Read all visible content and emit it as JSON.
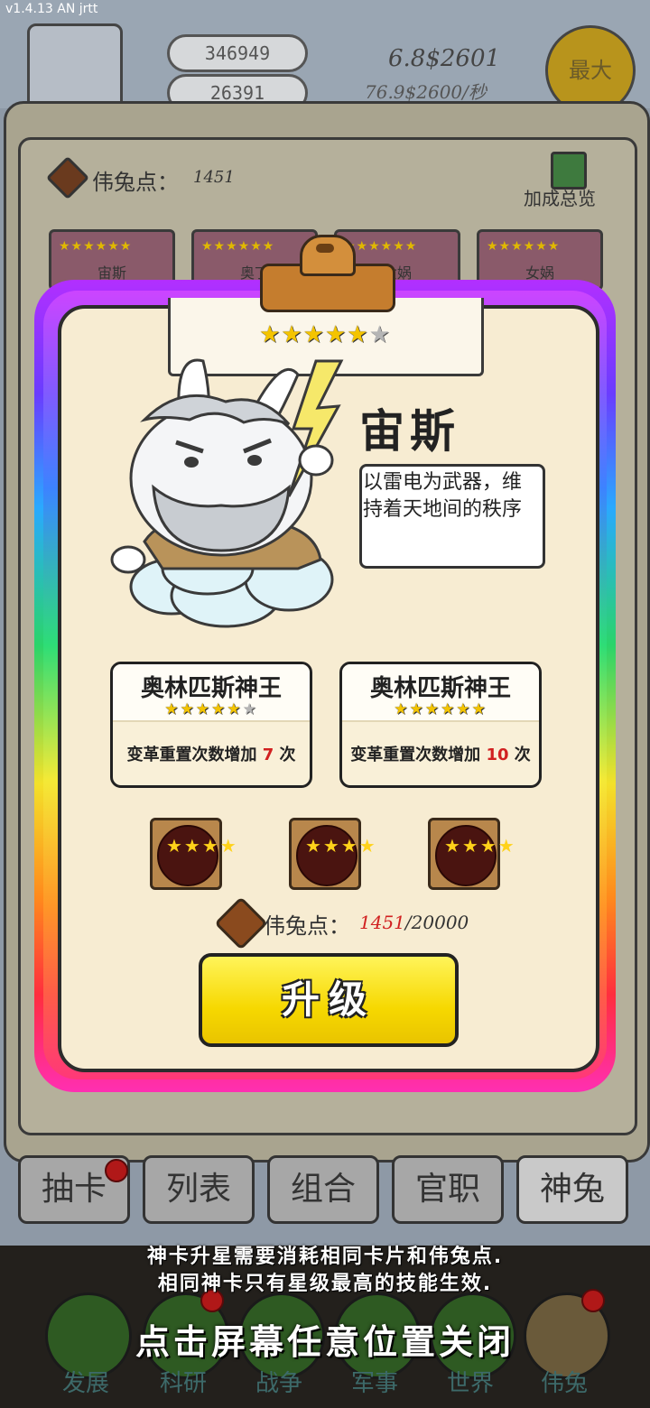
{
  "version": "v1.4.13 AN jrtt",
  "topbar": {
    "gem_count": "346949",
    "mail_count": "26391",
    "gold_amount": "6.8$2601",
    "gold_rate": "76.9$2600/秒",
    "max_label": "最大"
  },
  "panel": {
    "points_label": "伟兔点：",
    "points_value": "1451",
    "bonus_label": "加成总览",
    "mini_cards": [
      {
        "stars": "★★★★★★",
        "name": "宙斯"
      },
      {
        "stars": "★★★★★★",
        "name": "奥丁"
      },
      {
        "stars": "★★★★★★",
        "name": "女娲"
      },
      {
        "stars": "★★★★★★",
        "name": "女娲"
      }
    ],
    "tabs": [
      "抽卡",
      "列表",
      "组合",
      "官职",
      "神兔"
    ]
  },
  "bottom_nav": [
    "发展",
    "科研",
    "战争",
    "军事",
    "世界",
    "伟兔"
  ],
  "modal": {
    "rating": {
      "filled": 5,
      "total": 6,
      "stars_on": "★★★★★",
      "stars_off": "★"
    },
    "name": "宙斯",
    "description": "以雷电为武器，维持着天地间的秩序",
    "skills": [
      {
        "title": "奥林匹斯神王",
        "stars_on": "★★★★★",
        "stars_off": "★",
        "desc_prefix": "变革重置次数增加 ",
        "num": "7",
        "desc_suffix": " 次"
      },
      {
        "title": "奥林匹斯神王",
        "stars_on": "★★★★★★",
        "stars_off": "",
        "desc_prefix": "变革重置次数增加 ",
        "num": "10",
        "desc_suffix": " 次"
      }
    ],
    "slots": [
      "★★★★",
      "★★★★",
      "★★★★"
    ],
    "points": {
      "label": "伟兔点：",
      "current": "1451",
      "required": "/20000"
    },
    "upgrade_label": "升级"
  },
  "hints": {
    "line1": "神卡升星需要消耗相同卡片和伟兔点.",
    "line2": "相同神卡只有星级最高的技能生效.",
    "close": "点击屏幕任意位置关闭"
  },
  "colors": {
    "accent_yellow": "#f6d800",
    "highlight_red": "#d12020",
    "card_bg": "#f7ecd2"
  }
}
